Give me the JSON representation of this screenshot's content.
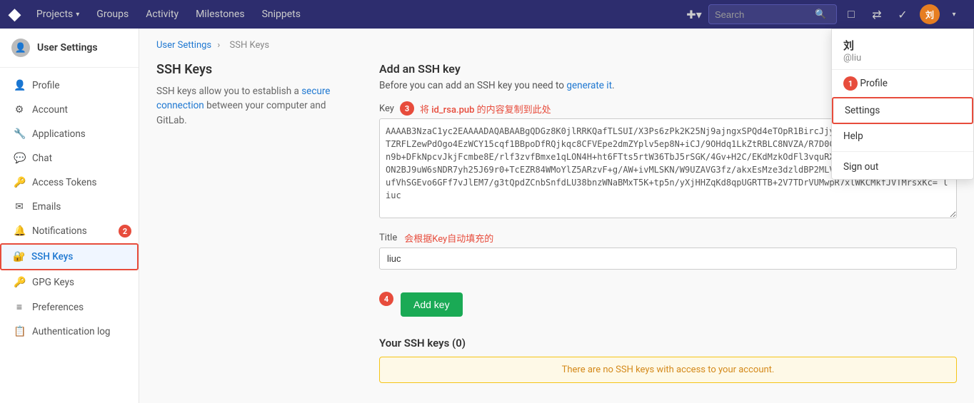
{
  "nav": {
    "logo": "☰",
    "links": [
      "Projects",
      "Groups",
      "Activity",
      "Milestones",
      "Snippets"
    ],
    "projects_chevron": "▾",
    "search_placeholder": "Search"
  },
  "dropdown": {
    "name": "刘",
    "username": "@liu",
    "badge_number": "1",
    "items": [
      "Profile",
      "Settings",
      "Help",
      "Sign out"
    ]
  },
  "sidebar": {
    "header_title": "User Settings",
    "items": [
      {
        "id": "profile",
        "icon": "👤",
        "label": "Profile"
      },
      {
        "id": "account",
        "icon": "⚙",
        "label": "Account"
      },
      {
        "id": "applications",
        "icon": "🔧",
        "label": "Applications"
      },
      {
        "id": "chat",
        "icon": "💬",
        "label": "Chat"
      },
      {
        "id": "access-tokens",
        "icon": "🔑",
        "label": "Access Tokens"
      },
      {
        "id": "emails",
        "icon": "✉",
        "label": "Emails"
      },
      {
        "id": "notifications",
        "icon": "🔔",
        "label": "Notifications",
        "badge": "2"
      },
      {
        "id": "ssh-keys",
        "icon": "🔐",
        "label": "SSH Keys",
        "active": true
      },
      {
        "id": "gpg-keys",
        "icon": "🔑",
        "label": "GPG Keys"
      },
      {
        "id": "preferences",
        "icon": "≡",
        "label": "Preferences"
      },
      {
        "id": "auth-log",
        "icon": "📋",
        "label": "Authentication log"
      }
    ]
  },
  "breadcrumb": {
    "parent": "User Settings",
    "current": "SSH Keys"
  },
  "left_panel": {
    "title": "SSH Keys",
    "description_before": "SSH keys allow you to establish a",
    "description_link": "secure connection",
    "description_after": "between your computer and GitLab."
  },
  "right_panel": {
    "add_title": "Add an SSH key",
    "add_subtitle_before": "Before you can add an SSH key you need to",
    "add_subtitle_link": "generate it",
    "key_label": "Key",
    "key_chinese_hint": "将 id_rsa.pub 的内容复制到此处",
    "key_value": "AAAAB3NzaC1yc2EAAAADAQABAABgQDGz8K0jlRRKQafTLSUI/X3Ps6zPk2K25Nj9ajngxSPQd4eTOpR1BircJjynTL9/ixQFo59qY3rAwSg+yTZRFLZewPdOgo4EzWCY15cqf1BBpoDfRQjkqc8CFVEpe2dmZYplv5ep8N+iCJ/9OHdq1LkZtRBLC8NVZA/R7D0C7B3fon31962Tn4NL84Q+0Mn9b+DFkNpcvJkjFcmbe8E/rlf3zvfBmxe1qLON4H+ht6FTts5rtW36TbJ5rSGK/4Gv+H2C/EKdMzkOdFl3vquRX/o/kD6MhN98fT0ch0xOUN0ON2BJ9uW6sNDR7yh25J69r0+TcEZR84WMoYlZ5ARzvF+g/AW+ivMLSKN/W9UZAVG3fz/akxEsMze3dzldBP2MLVZekxagf4sqr6rOA20MbOT/ufVhSGEvo6GFf7vJlEM7/g3tQpdZCnbSnfdLU38bnzWNaBMxT5K+tp5n/yXjHHZqKd8qpUGRTTB+2V7TDrVUMwpR7xlWKCMkfJVTMrsxKc= liuc",
    "title_label": "Title",
    "title_chinese_hint": "会根据Key自动填充的",
    "title_value": "liuc",
    "add_btn": "Add key",
    "your_keys_title": "Your SSH keys (0)",
    "no_keys_msg": "There are no SSH keys with access to your account.",
    "step3": "3",
    "step4": "4"
  }
}
